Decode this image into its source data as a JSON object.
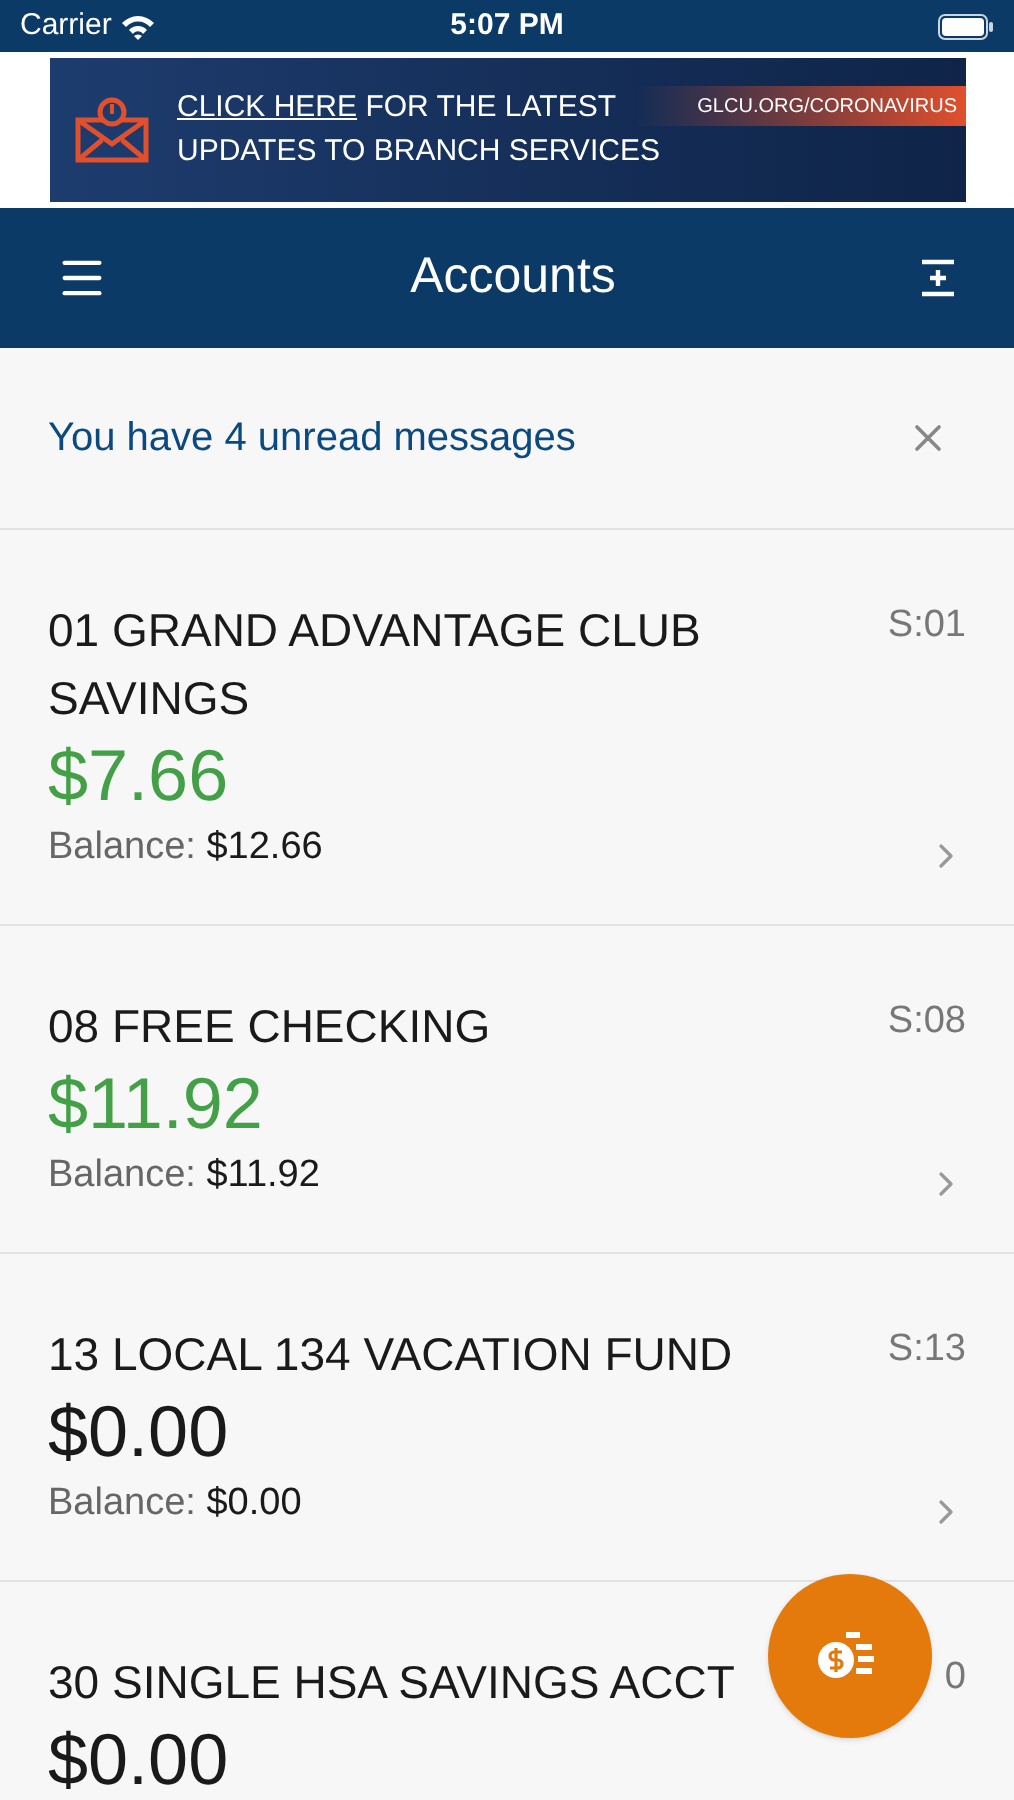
{
  "status_bar": {
    "carrier": "Carrier",
    "time": "5:07 PM"
  },
  "banner": {
    "link": "CLICK HERE",
    "text_1": " FOR THE LATEST",
    "text_2": "UPDATES TO BRANCH SERVICES",
    "url": "GLCU.ORG/CORONAVIRUS"
  },
  "header": {
    "title": "Accounts"
  },
  "messages": {
    "text": "You have 4 unread messages"
  },
  "accounts": [
    {
      "name": "01 GRAND ADVANTAGE CLUB SAVINGS",
      "code": "S:01",
      "available": "$7.66",
      "color": "#43a047",
      "balance_label": "Balance:",
      "balance": "$12.66"
    },
    {
      "name": "08 FREE CHECKING",
      "code": "S:08",
      "available": "$11.92",
      "color": "#43a047",
      "balance_label": "Balance:",
      "balance": "$11.92"
    },
    {
      "name": "13 LOCAL 134 VACATION FUND",
      "code": "S:13",
      "available": "$0.00",
      "color": "#1a1a1a",
      "balance_label": "Balance:",
      "balance": "$0.00"
    },
    {
      "name": "30 SINGLE HSA SAVINGS ACCT",
      "code": "0",
      "available": "$0.00",
      "color": "#1a1a1a"
    }
  ]
}
